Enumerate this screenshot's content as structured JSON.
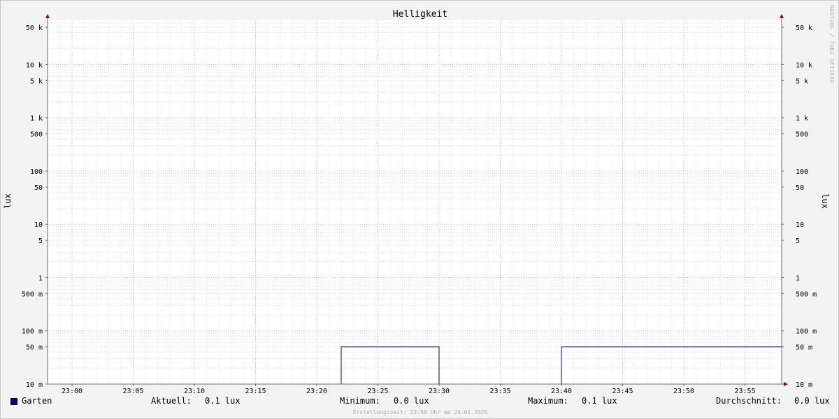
{
  "watermark": "RRDTOOL / TOBI OETIKER",
  "chart_data": {
    "type": "line",
    "title": "Helligkeit",
    "ylabel": "lux",
    "yscale": "log",
    "ylim": [
      0.01,
      70000
    ],
    "xlim": [
      "22:58",
      "23:58"
    ],
    "x_ticks": [
      "23:00",
      "23:05",
      "23:10",
      "23:15",
      "23:20",
      "23:25",
      "23:30",
      "23:35",
      "23:40",
      "23:45",
      "23:50",
      "23:55"
    ],
    "y_ticks": [
      {
        "value": 50000,
        "label": "50 k"
      },
      {
        "value": 10000,
        "label": "10 k"
      },
      {
        "value": 5000,
        "label": "5 k"
      },
      {
        "value": 1000,
        "label": "1 k"
      },
      {
        "value": 500,
        "label": "500"
      },
      {
        "value": 100,
        "label": "100"
      },
      {
        "value": 50,
        "label": "50"
      },
      {
        "value": 10,
        "label": "10"
      },
      {
        "value": 5,
        "label": "5"
      },
      {
        "value": 1,
        "label": "1"
      },
      {
        "value": 0.5,
        "label": "500 m"
      },
      {
        "value": 0.1,
        "label": "100 m"
      },
      {
        "value": 0.05,
        "label": "50 m"
      },
      {
        "value": 0.01,
        "label": "10 m"
      }
    ],
    "grid": true,
    "series": [
      {
        "name": "Garten",
        "color": "#00007f",
        "points": [
          {
            "x": "22:58",
            "y": 0.01
          },
          {
            "x": "23:22",
            "y": 0.01
          },
          {
            "x": "23:22",
            "y": 0.05
          },
          {
            "x": "23:30",
            "y": 0.05
          },
          {
            "x": "23:30",
            "y": 0.01
          },
          {
            "x": "23:40",
            "y": 0.01
          },
          {
            "x": "23:40",
            "y": 0.05
          },
          {
            "x": "23:58",
            "y": 0.05
          }
        ]
      }
    ]
  },
  "legend": {
    "series_name": "Garten",
    "swatch_color": "#00007f",
    "stats": [
      {
        "label": "Aktuell:",
        "value": "0.1 lux"
      },
      {
        "label": "Minimum:",
        "value": "0.0 lux"
      },
      {
        "label": "Maximum:",
        "value": "0.1 lux"
      },
      {
        "label": "Durchschnitt:",
        "value": "0.0 lux"
      }
    ]
  },
  "footer": "Erstellungszeit: 23:58 Uhr am 24.01.2026"
}
